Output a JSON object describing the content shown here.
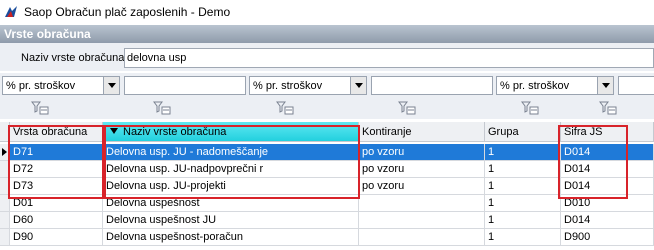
{
  "window": {
    "title": "Saop Obračun plač zaposlenih - Demo",
    "icon": "app-icon"
  },
  "section": {
    "title": "Vrste obračuna"
  },
  "search": {
    "label": "Naziv vrste obračuna",
    "value": "delovna usp"
  },
  "filters": {
    "combo_value": "% pr. stroškov"
  },
  "grid": {
    "columns": [
      "Vrsta obračuna",
      "Naziv vrste obračuna",
      "Kontiranje",
      "Grupa",
      "Šifra JS"
    ],
    "sorted_column": "Naziv vrste obračuna",
    "rows": [
      [
        "D71",
        "Delovna usp. JU - nadomeščanje",
        "po vzoru",
        "1",
        "D014"
      ],
      [
        "D72",
        "Delovna usp. JU-nadpovprečni r",
        "po vzoru",
        "1",
        "D014"
      ],
      [
        "D73",
        "Delovna usp. JU-projekti",
        "po vzoru",
        "1",
        "D014"
      ],
      [
        "D01",
        "Delovna uspešnost",
        "",
        "1",
        "D010"
      ],
      [
        "D60",
        "Delovna uspešnost JU",
        "",
        "1",
        "D014"
      ],
      [
        "D90",
        "Delovna uspešnost-poračun",
        "",
        "1",
        "D900"
      ]
    ],
    "selected_row": 0
  },
  "colors": {
    "selection": "#1f7ad8",
    "highlight": "#d8232a",
    "sorted_header": "#22d0de"
  }
}
